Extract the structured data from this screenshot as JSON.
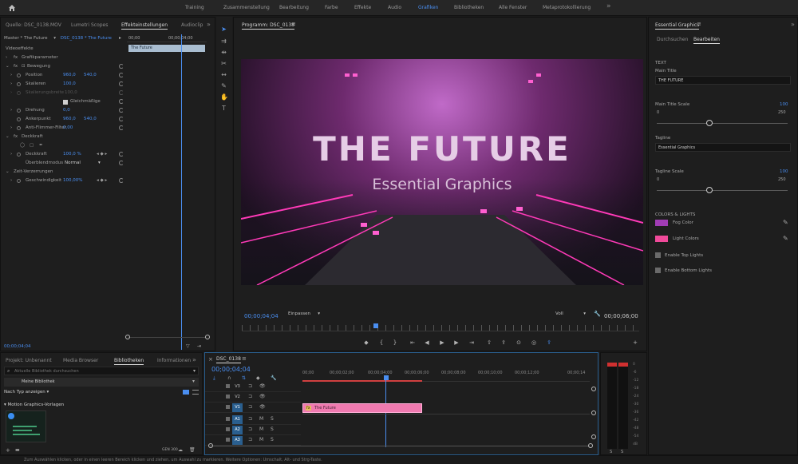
{
  "workspaces": [
    "Training",
    "Zusammenstellung",
    "Bearbeitung",
    "Farbe",
    "Effekte",
    "Audio",
    "Grafiken",
    "Bibliotheken",
    "Alle Fenster",
    "Metaprotokollierung"
  ],
  "active_workspace": "Grafiken",
  "source_panel": {
    "tabs": [
      "Quelle: DSC_0138.MOV",
      "Lumetri Scopes",
      "Effekteinstellungen",
      "Audioclip"
    ],
    "active_tab": "Effekteinstellungen",
    "master_label": "Master * The Future",
    "sequence_label": "DSC_0138 * The Future",
    "ruler_labels": [
      "00;00",
      "00;00;04;00"
    ],
    "clip_name": "The Future",
    "video_effects": "Videoeffekte",
    "graphics_params": "Grafikparameter",
    "motion": "Bewegung",
    "position_label": "Position",
    "position_x": "960,0",
    "position_y": "540,0",
    "scale_label": "Skalieren",
    "scale_value": "100,0",
    "scale_width_label": "Skalierungsbreite",
    "scale_width_value": "100,0",
    "uniform_scale": "Gleichmäßige",
    "rotation_label": "Drehung",
    "rotation_value": "0,0",
    "anchor_label": "Ankerpunkt",
    "anchor_x": "960,0",
    "anchor_y": "540,0",
    "antiflicker_label": "Anti-Flimmer-Filter",
    "antiflicker_value": "0,00",
    "opacity_section": "Deckkraft",
    "opacity_label": "Deckkraft",
    "opacity_value": "100,0 %",
    "blend_label": "Überblendmodus",
    "blend_value": "Normal",
    "time_remap": "Zeit-Verzerrungen",
    "speed_label": "Geschwindigkeit",
    "speed_value": "100,00%",
    "timecode": "00;00;04;04"
  },
  "program_monitor": {
    "title": "Programm: DSC_0138",
    "video_title": "THE FUTURE",
    "video_subtitle": "Essential Graphics",
    "timecode": "00;00;04;04",
    "fit": "Einpassen",
    "quality": "Voll",
    "duration": "00;00;06;00"
  },
  "essential_graphics": {
    "title": "Essential Graphics",
    "tabs": [
      "Durchsuchen",
      "Bearbeiten"
    ],
    "active_tab": "Bearbeiten",
    "text_section": "TEXT",
    "main_title_label": "Main Title",
    "main_title_value": "THE FUTURE",
    "main_title_scale_label": "Main Title Scale",
    "main_title_scale_value": "100",
    "main_title_scale_min": "0",
    "main_title_scale_max": "250",
    "main_title_scale_level": 0.4,
    "tagline_label": "Tagline",
    "tagline_value": "Essential Graphics",
    "tagline_scale_label": "Tagline Scale",
    "tagline_scale_value": "100",
    "tagline_scale_min": "0",
    "tagline_scale_max": "250",
    "tagline_scale_level": 0.4,
    "colors_section": "COLORS & LIGHTS",
    "fog_label": "Fog Color",
    "fog_color": "#a03cb4",
    "light_label": "Light Colors",
    "light_color": "#f04a9a",
    "top_lights": "Enable Top Lights",
    "bottom_lights": "Enable Bottom Lights"
  },
  "library_panel": {
    "tabs": [
      "Projekt: Unbenannt",
      "Media Browser",
      "Bibliotheken",
      "Informationen"
    ],
    "active_tab": "Bibliotheken",
    "search_placeholder": "Aktuelle Bibliothek durchsuchen",
    "library_name": "Meine Bibliothek",
    "sort_label": "Nach Typ anzeigen",
    "group_label": "Motion Graphics-Vorlagen",
    "footer_label": "GEN 300"
  },
  "timeline": {
    "sequence_tab": "DSC_0138",
    "timecode": "00;00;04;04",
    "ruler_labels": [
      "00;00",
      "00;00;02;00",
      "00;00;04;00",
      "00;00;06;00",
      "00;00;08;00",
      "00;00;10;00",
      "00;00;12;00",
      "00;00;14"
    ],
    "tracks": [
      "V3",
      "V2",
      "V1",
      "A1",
      "A2",
      "A3",
      "A4"
    ],
    "clip_label": "The Future",
    "clip_badge": "fx"
  },
  "audio_meter": {
    "ticks": [
      "0",
      "-6",
      "-12",
      "-18",
      "-24",
      "-30",
      "-36",
      "-42",
      "-48",
      "-54",
      "dB"
    ],
    "solo_labels": [
      "S",
      "S"
    ]
  },
  "status_bar": "Zum Auswählen klicken, oder in einen leeren Bereich klicken und ziehen, um Auswahl zu markieren. Weitere Optionen: Umschalt, Alt- und Strg-Taste."
}
